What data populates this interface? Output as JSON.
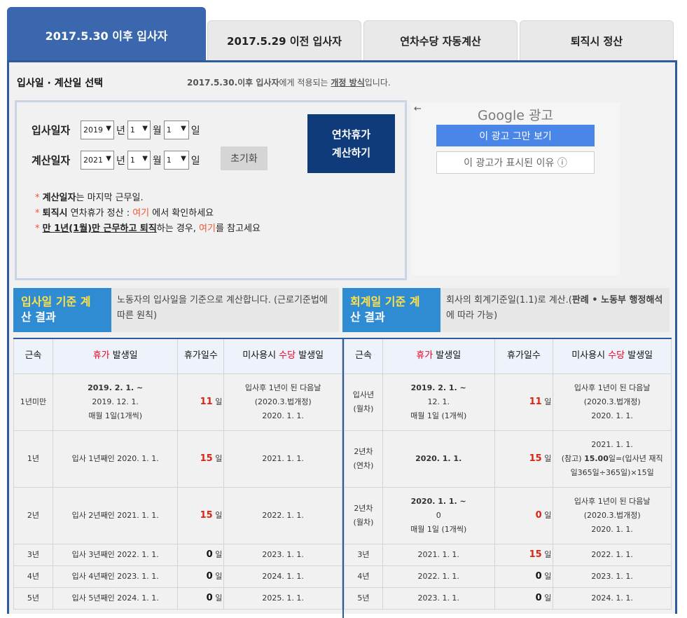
{
  "tabs": [
    {
      "label": "2017.5.30 이후 입사자"
    },
    {
      "label": "2017.5.29 이전 입사자"
    },
    {
      "label": "연차수당 자동계산"
    },
    {
      "label": "퇴직시 정산"
    }
  ],
  "selector": {
    "title": "입사일 · 계산일 선택",
    "desc_pre": "2017.5.30.",
    "desc_b": "이후 입사자",
    "desc_mid": "에게 적용되는 ",
    "desc_u": "개정 방식",
    "desc_post": "입니다."
  },
  "form": {
    "join": {
      "label": "입사일자",
      "year": "2019",
      "month": "1",
      "day": "1"
    },
    "calc": {
      "label": "계산일자",
      "year": "2021",
      "month": "1",
      "day": "1"
    },
    "units": {
      "year": "년",
      "month": "월",
      "day": "일"
    },
    "reset": "초기화",
    "calc_button": [
      "연차휴가",
      "계산하기"
    ],
    "notes": [
      {
        "star": "* ",
        "b": "계산일자",
        "rest": "는 마지막 근무일."
      },
      {
        "star": "* ",
        "b": "퇴직시",
        "rest": " 연차휴가 정산 : ",
        "red": "여기",
        "rest2": " 에서 확인하세요"
      },
      {
        "star": "* ",
        "b": "만 1년(1월)만 근무하고 퇴직",
        "rest": "하는 경우, ",
        "red": "여기",
        "rest2": "를 참고세요"
      }
    ]
  },
  "ad": {
    "back": "←",
    "logo": "Google 광고",
    "stop": "이 광고 그만 보기",
    "why": "이 광고가 표시된 이유 ⓘ"
  },
  "left_head": {
    "lab1": "입사일 기준",
    "lab2": " 계",
    "lab3": "산 결과",
    "desc": "노동자의 입사일을 기준으로 계산합니다. (근로기준법에 따른 원칙)"
  },
  "right_head": {
    "lab1": "회계일 기준",
    "lab2": " 계",
    "lab3": "산 결과",
    "desc_a": "회사의 회계기준일(1.1)로 계산.(",
    "desc_b": "판례 • 노동부 행정해석",
    "desc_c": "에 따라 가능)"
  },
  "cols": {
    "tenure": "근속",
    "occur_red": "휴가",
    "occur": " 발생일",
    "days": "휴가일수",
    "unused_a": "미사용시 ",
    "unused_red": "수당",
    "unused_b": " 발생일"
  },
  "day_unit": "일",
  "left_rows": [
    {
      "t": "1년미만",
      "o1": "2019. 2. 1.    ~",
      "o2": "2019. 12. 1.",
      "o3": "매월 1일(1개씩)",
      "n": "11",
      "u1": "입사후 1년이 된 다음날",
      "u2": "(2020.3.법개정)",
      "u3": "2020. 1. 1."
    },
    {
      "t": "1년",
      "o1": "입사 1년째인 2020. 1. 1.",
      "n": "15",
      "u1": "2021. 1. 1."
    },
    {
      "t": "2년",
      "o1": "입사 2년째인 2021. 1. 1.",
      "n": "15",
      "u1": "2022. 1. 1."
    },
    {
      "t": "3년",
      "o1": "입사 3년째인 2022. 1. 1.",
      "n": "0",
      "u1": "2023. 1. 1."
    },
    {
      "t": "4년",
      "o1": "입사 4년째인 2023. 1. 1.",
      "n": "0",
      "u1": "2024. 1. 1."
    },
    {
      "t": "5년",
      "o1": "입사 5년째인 2024. 1. 1.",
      "n": "0",
      "u1": "2025. 1. 1."
    }
  ],
  "right_rows": [
    {
      "t1": "입사년",
      "t2": "(월차)",
      "o1": "2019. 2. 1.    ~",
      "o2": "12. 1.",
      "o3": "매월 1일 (1개씩)",
      "n": "11",
      "u1": "입사후 1년이 된 다음날",
      "u2": "(2020.3.법개정)",
      "u3": "2020. 1. 1."
    },
    {
      "t1": "2년차",
      "t2": "(연차)",
      "o1": "2020. 1. 1.",
      "n": "15",
      "u1": "2021. 1. 1.",
      "u2a": "(참고) ",
      "u2b": "15.00",
      "u2c": "일=(입사년 재직",
      "u3": "일365일÷365일)×15일"
    },
    {
      "t1": "2년차",
      "t2": "(월차)",
      "o1": "2020. 1. 1.    ~",
      "o2": "0",
      "o3": "매월 1일 (1개씩)",
      "n": "0",
      "u1": "입사후 1년이 된 다음날",
      "u2": "(2020.3.법개정)",
      "u3": "2020. 1. 1."
    },
    {
      "t1": "3년",
      "o1": "2021. 1. 1.",
      "n": "15",
      "u1": "2022. 1. 1."
    },
    {
      "t1": "4년",
      "o1": "2022. 1. 1.",
      "n": "0",
      "u1": "2023. 1. 1."
    },
    {
      "t1": "5년",
      "o1": "2023. 1. 1.",
      "n": "0",
      "u1": "2024. 1. 1."
    }
  ]
}
